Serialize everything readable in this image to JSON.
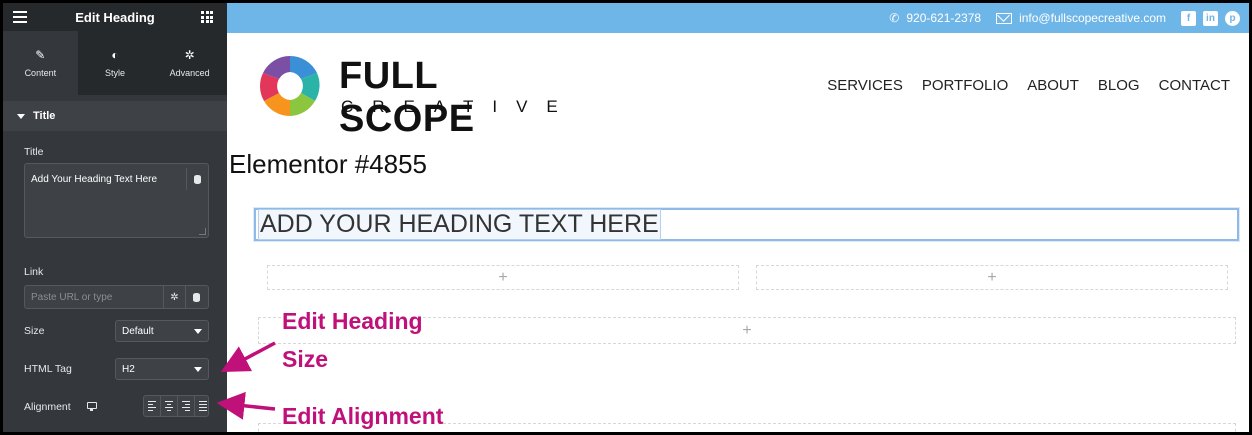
{
  "panel": {
    "title": "Edit Heading",
    "tabs": [
      {
        "label": "Content",
        "icon": "pencil-icon",
        "active": true
      },
      {
        "label": "Style",
        "icon": "contrast-icon",
        "active": false
      },
      {
        "label": "Advanced",
        "icon": "gear-icon",
        "active": false
      }
    ],
    "section": "Title",
    "title_label": "Title",
    "title_value": "Add Your Heading Text Here",
    "link_label": "Link",
    "link_placeholder": "Paste URL or type",
    "size_label": "Size",
    "size_value": "Default",
    "html_tag_label": "HTML Tag",
    "html_tag_value": "H2",
    "alignment_label": "Alignment",
    "collapse_glyph": "‹",
    "colors": {
      "panel_bg": "#34383c",
      "header_bg": "#26292c"
    }
  },
  "site": {
    "phone": "920-621-2378",
    "email": "info@fullscopecreative.com",
    "social": [
      "f",
      "in",
      "p"
    ],
    "logo_main": "FULL SCOPE",
    "logo_sub": "CREATIVE",
    "nav": [
      "SERVICES",
      "PORTFOLIO",
      "ABOUT",
      "BLOG",
      "CONTACT"
    ],
    "page_title": "Elementor #4855",
    "heading_text": "ADD YOUR HEADING TEXT HERE",
    "add_glyph": "+",
    "colors": {
      "topbar": "#6fb6e8",
      "selection": "#8fb9e6"
    }
  },
  "annotations": {
    "size_line1": "Edit Heading",
    "size_line2": "Size",
    "alignment": "Edit Alignment",
    "color": "#c0107a"
  }
}
